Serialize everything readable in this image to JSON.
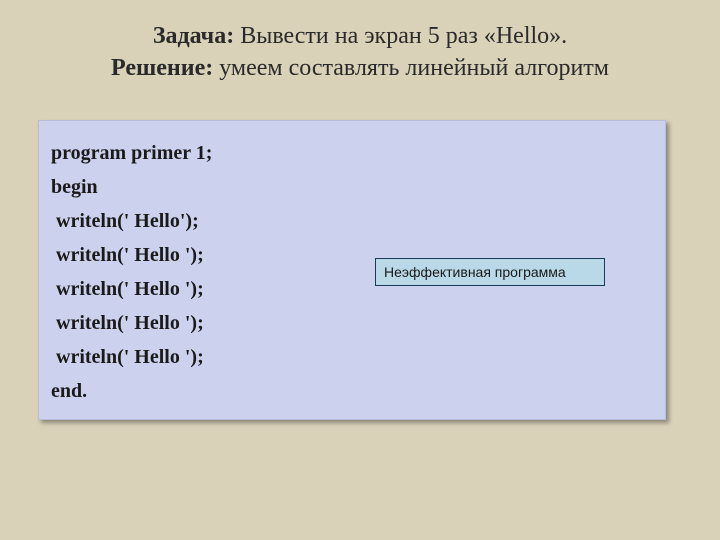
{
  "heading": {
    "task_label": "Задача:",
    "task_text": " Вывести на экран 5 раз «Hello».",
    "solution_label": "Решение:",
    "solution_text": " умеем составлять линейный алгоритм"
  },
  "code": {
    "l1": "program primer 1;",
    "l2": "begin",
    "l3": " writeln(' Hello');",
    "l4": " writeln(' Hello ');",
    "l5": " writeln(' Hello ');",
    "l6": " writeln(' Hello ');",
    "l7": " writeln(' Hello ');",
    "l8": "end."
  },
  "note": "Неэффективная программа"
}
